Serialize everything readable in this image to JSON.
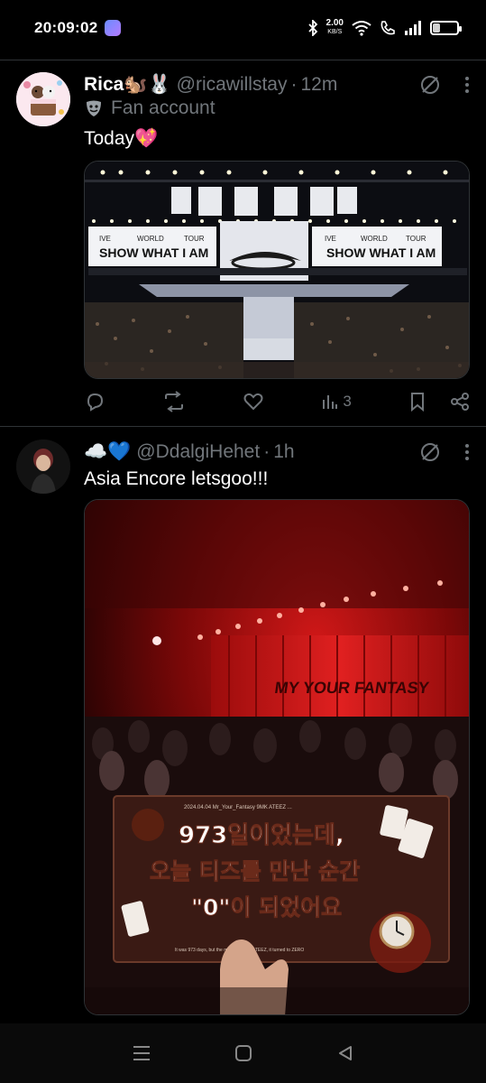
{
  "status_bar": {
    "time": "20:09:02",
    "net_speed_value": "2.00",
    "net_speed_unit": "KB/S",
    "battery_level": "30",
    "battery_fraction": 0.3
  },
  "tweets": [
    {
      "name": "Rica🐿️🐰",
      "handle": "@ricawillstay",
      "dot": "·",
      "time": "12m",
      "fan_label": "Fan account",
      "text": "Today💖",
      "image": {
        "banner_small_left": "IVE",
        "banner_small_mid": "WORLD",
        "banner_small_right": "TOUR",
        "banner_title": "SHOW WHAT I AM"
      },
      "views": "3"
    },
    {
      "name": "☁️💙",
      "handle": "@DdalgiHehet",
      "dot": "·",
      "time": "1h",
      "text": "Asia Encore letsgoo!!!",
      "image": {
        "stage_text": "MY YOUR FANTASY",
        "card_header": "2024.04.04 Mr_Your_Fantasy 9MK ATEEZ ...",
        "card_line1": "973일이었는데,",
        "card_line2": "오늘 티즈를 만난 순간",
        "card_line3": "\"0\"이 되었어요",
        "card_footer": "It was 973 days, but the moment I met ATEEZ, it turned to ZERO"
      }
    }
  ]
}
